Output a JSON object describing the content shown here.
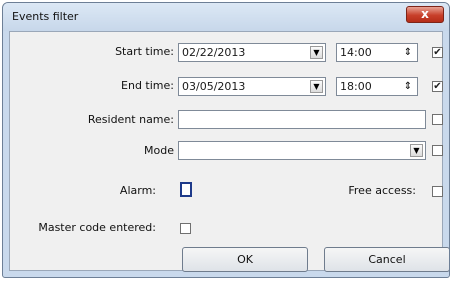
{
  "window": {
    "title": "Events filter",
    "close_symbol": "x"
  },
  "fields": {
    "start_time": {
      "label": "Start time:",
      "date": "02/22/2013",
      "time": "14:00",
      "checked": true,
      "check_mark": "✔"
    },
    "end_time": {
      "label": "End time:",
      "date": "03/05/2013",
      "time": "18:00",
      "checked": true,
      "check_mark": "✔"
    },
    "resident_name": {
      "label": "Resident name:",
      "value": "",
      "checked": false
    },
    "mode": {
      "label": "Mode",
      "value": "",
      "checked": false
    },
    "alarm": {
      "label": "Alarm:",
      "checked": false
    },
    "free_access": {
      "label": "Free access:",
      "checked": false
    },
    "master_code": {
      "label": "Master code entered:",
      "checked": false
    }
  },
  "icons": {
    "dropdown": "▼",
    "spin": "⇕"
  },
  "buttons": {
    "ok": "OK",
    "cancel": "Cancel"
  }
}
